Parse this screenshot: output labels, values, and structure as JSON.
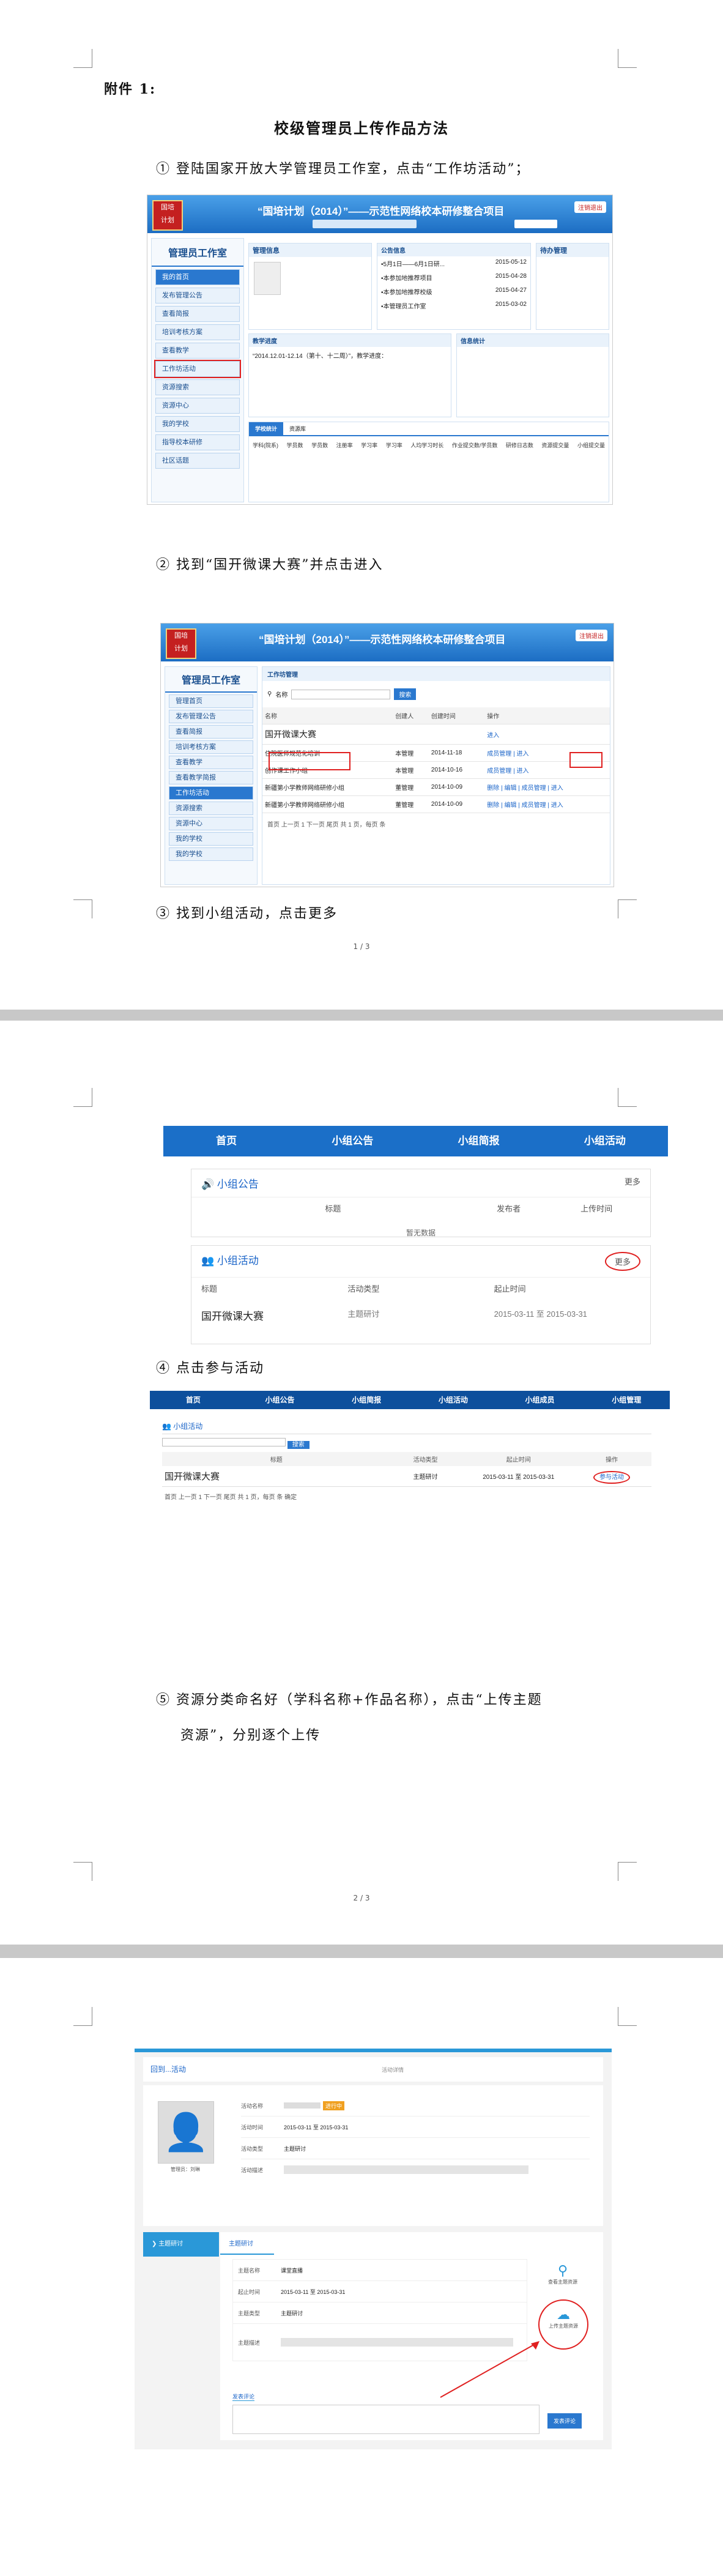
{
  "page1": {
    "annex_label": "附件 1:",
    "doc_title": "校级管理员上传作品方法",
    "step1": "① 登陆国家开放大学管理员工作室，点击“工作坊活动”；",
    "step2": "② 找到“国开微课大赛”并点击进入",
    "step3": "③ 找到小组活动，点击更多",
    "page_num": "1 / 3",
    "shot1": {
      "banner": "“国培计划（2014）”——示范性网络校本研修整合项目",
      "logout": "注销退出",
      "sidebar_title": "管理员工作室",
      "sidebar_items": [
        "我的首页",
        "发布管理公告",
        "查看简报",
        "培训考核方案",
        "查看教学",
        "工作坊活动",
        "资源搜索",
        "资源中心",
        "我的学校",
        "指导校本研修",
        "社区话题"
      ],
      "panel_info": "管理信息",
      "panel_notice": "公告信息",
      "panel_todo": "待办管理",
      "notices": [
        {
          "text": "•5月1日——6月1日研...",
          "date": "2015-05-12"
        },
        {
          "text": "•本参加地推荐项目",
          "date": "2015-04-28"
        },
        {
          "text": "•本参加地推荐校级",
          "date": "2015-04-27"
        },
        {
          "text": "•本管理员工作室",
          "date": "2015-03-02"
        }
      ],
      "panel_teach": "教学进度",
      "panel_stats": "信息统计",
      "teach_text": "“2014.12.01-12.14（第十、十二周）”，教学进度：",
      "tab_stats": "学校统计",
      "tab_res": "资源库",
      "cols": [
        "学科(院系)",
        "学员数",
        "学员数",
        "注册率",
        "学习率",
        "学习率",
        "人均学习时长",
        "作业提交数/学员数",
        "研修日志数",
        "资源提交量",
        "小组提交量"
      ]
    },
    "shot2": {
      "banner": "“国培计划（2014）”——示范性网络校本研修整合项目",
      "logout": "注销退出",
      "sidebar_title": "管理员工作室",
      "sidebar_items": [
        "管理首页",
        "发布管理公告",
        "查看简报",
        "培训考核方案",
        "查看教学",
        "查看教学简报",
        "工作坊活动",
        "资源搜索",
        "资源中心",
        "我的学校",
        "我的学校"
      ],
      "tab": "工作坊管理",
      "search_label": "名称",
      "search_btn": "搜索",
      "cols": [
        "名称",
        "创建人",
        "创建时间",
        "操作"
      ],
      "rows": [
        {
          "name": "国开微课大赛",
          "creator": "",
          "date": "",
          "op": "进入"
        },
        {
          "name": "住院医师规范化培训",
          "creator": "本管理",
          "date": "2014-11-18",
          "op": "成员管理 | 进入"
        },
        {
          "name": "创作课工作小组",
          "creator": "本管理",
          "date": "2014-10-16",
          "op": "成员管理 | 进入"
        },
        {
          "name": "新疆第小学教师网络研修小组",
          "creator": "董管理",
          "date": "2014-10-09",
          "op": "删除 | 编辑 | 成员管理 | 进入"
        },
        {
          "name": "新疆第小学教师网络研修小组",
          "creator": "董管理",
          "date": "2014-10-09",
          "op": "删除 | 编辑 | 成员管理 | 进入"
        }
      ],
      "pager": "首页  上一页  1  下一页  尾页  共 1 页，每页  条"
    }
  },
  "page2": {
    "step4": "④ 点击参与活动",
    "step5_line1": "⑤ 资源分类命名好（学科名称+作品名称），点击“上传主题",
    "step5_line2": "资源”，分别逐个上传",
    "page_num": "2 / 3",
    "shot3": {
      "nav": [
        "首页",
        "小组公告",
        "小组简报",
        "小组活动"
      ],
      "notice_title": "小组公告",
      "more": "更多",
      "notice_cols": [
        "标题",
        "发布者",
        "上传时间"
      ],
      "empty": "暂无数据",
      "activity_title": "小组活动",
      "activity_cols": [
        "标题",
        "活动类型",
        "起止时间"
      ],
      "activity_row": {
        "title": "国开微课大赛",
        "type": "主题研讨",
        "period": "2015-03-11 至 2015-03-31"
      }
    },
    "shot4": {
      "nav": [
        "首页",
        "小组公告",
        "小组简报",
        "小组活动",
        "小组成员",
        "小组管理"
      ],
      "section": "小组活动",
      "search_btn": "搜索",
      "cols": [
        "标题",
        "活动类型",
        "起止时间",
        "操作"
      ],
      "row": {
        "title": "国开微课大赛",
        "type": "主题研讨",
        "period": "2015-03-11 至 2015-03-31",
        "op": "参与活动"
      },
      "pager": "首页  上一页  1  下一页  尾页  共 1 页，每页  条  确定"
    }
  },
  "page3": {
    "shot5": {
      "header": "回到...活动",
      "crumb": "活动详情",
      "labels": [
        "活动名称",
        "活动时间",
        "活动类型",
        "活动描述"
      ],
      "values": [
        "",
        "2015-03-11 至 2015-03-31",
        "主题研讨",
        ""
      ],
      "tag": "进行中",
      "side_tab": "主题研讨",
      "tab": "主题研讨",
      "labels2": [
        "主题名称",
        "起止时间",
        "主题类型",
        "主题描述"
      ],
      "values2": [
        "课堂直播",
        "2015-03-11 至 2015-03-31",
        "主题研讨",
        ""
      ],
      "icon1": "查看主题资源",
      "icon2": "上传主题资源",
      "comment": "发表评论",
      "comment_btn": "发表评论",
      "avatar_caption": "管理员：刘琳"
    }
  }
}
